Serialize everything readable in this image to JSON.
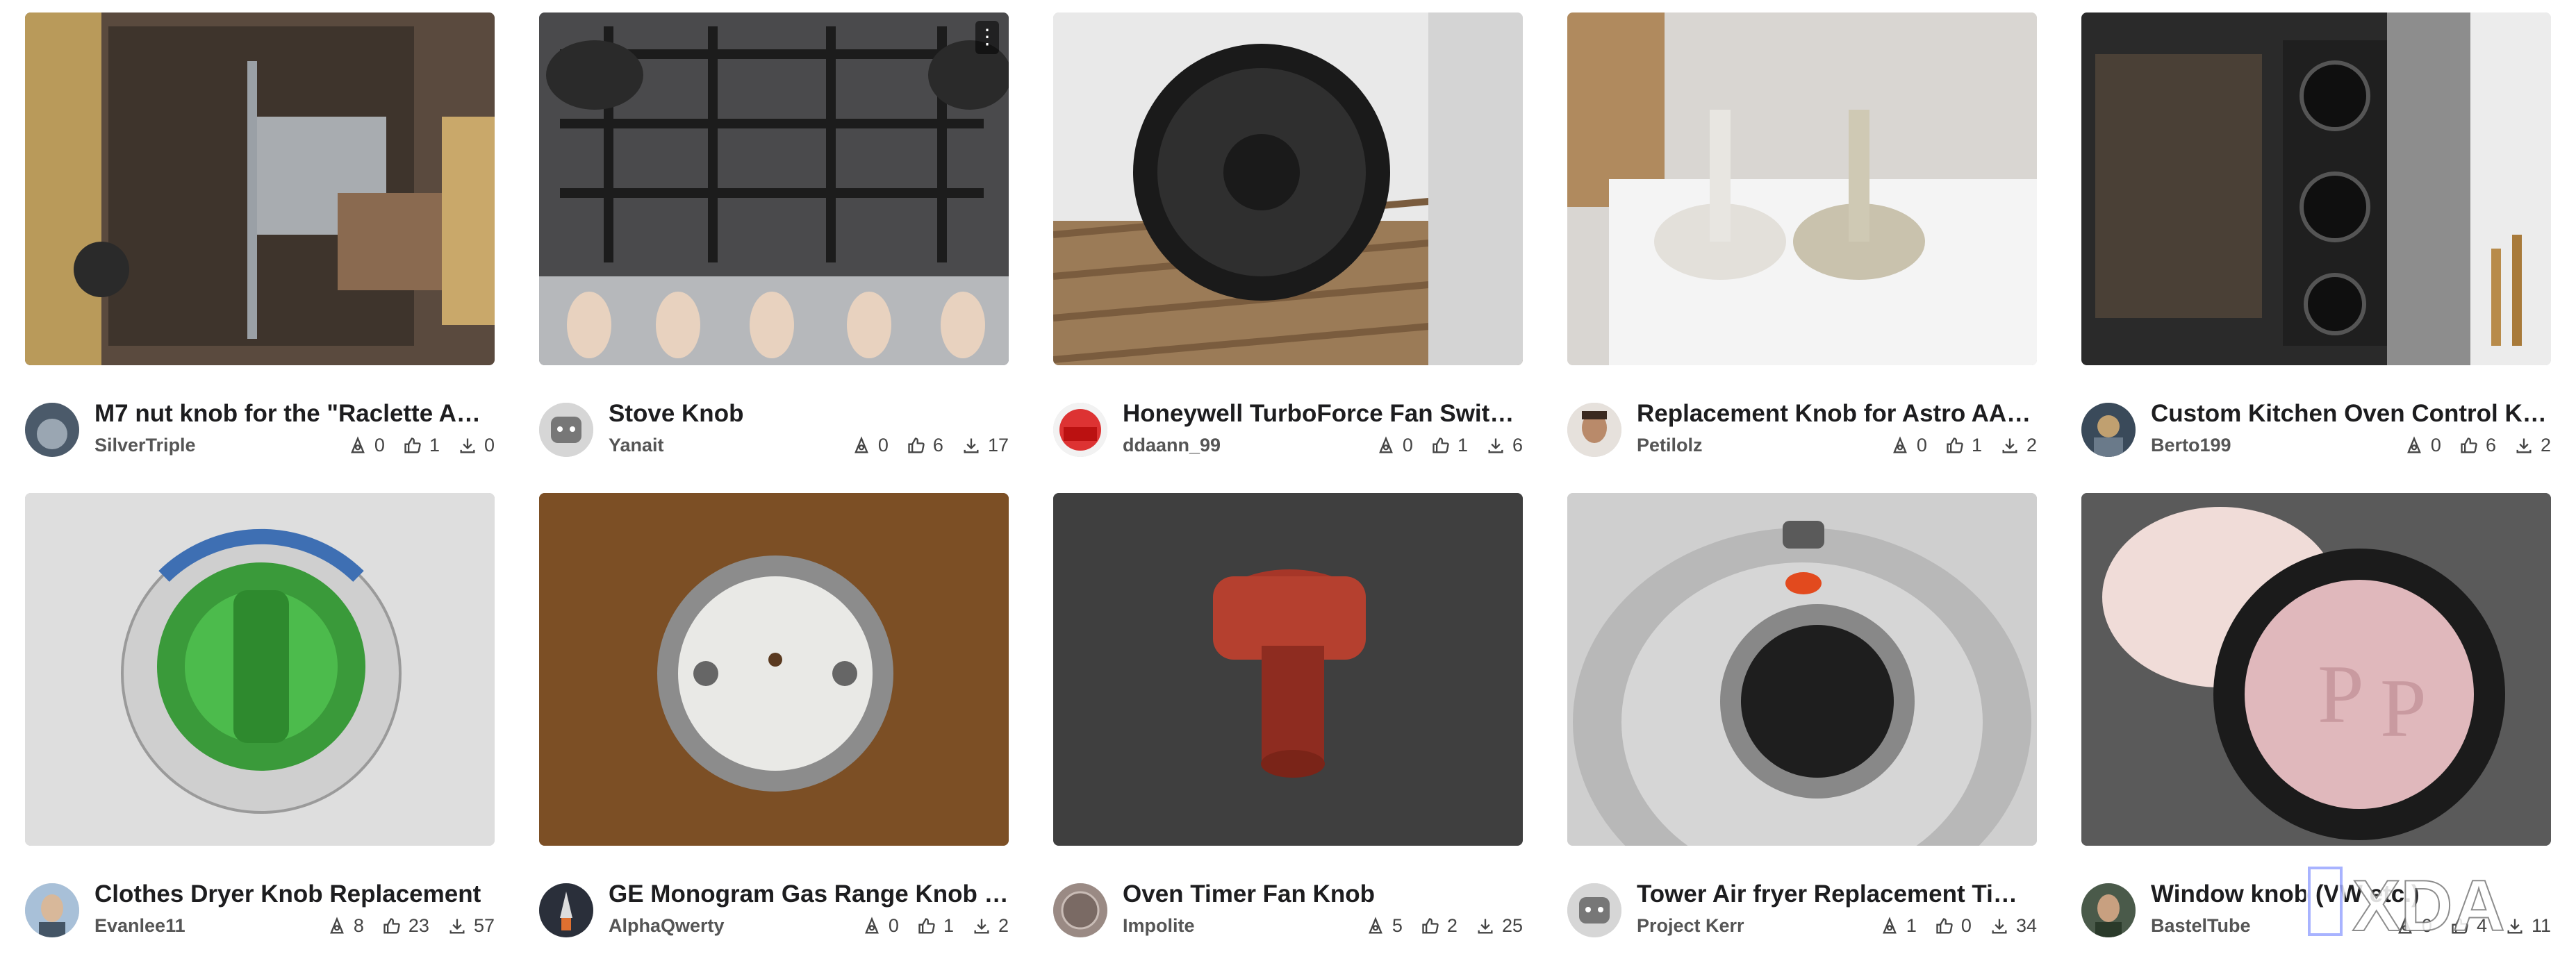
{
  "cards": [
    {
      "title": "M7 nut knob for the \"Raclette App...",
      "author": "SilverTriple",
      "stats": [
        "0",
        "1",
        "0"
      ]
    },
    {
      "title": "Stove Knob",
      "author": "Yanait",
      "stats": [
        "0",
        "6",
        "17"
      ]
    },
    {
      "title": "Honeywell TurboForce Fan Switch ...",
      "author": "ddaann_99",
      "stats": [
        "0",
        "1",
        "6"
      ]
    },
    {
      "title": "Replacement Knob for Astro AA-N...",
      "author": "Petilolz",
      "stats": [
        "0",
        "1",
        "2"
      ]
    },
    {
      "title": "Custom Kitchen Oven Control Kno...",
      "author": "Berto199",
      "stats": [
        "0",
        "6",
        "2"
      ]
    },
    {
      "title": "Clothes Dryer Knob Replacement",
      "author": "Evanlee11",
      "stats": [
        "8",
        "23",
        "57"
      ]
    },
    {
      "title": "GE Monogram Gas Range Knob Re...",
      "author": "AlphaQwerty",
      "stats": [
        "0",
        "1",
        "2"
      ]
    },
    {
      "title": "Oven Timer Fan Knob",
      "author": "Impolite",
      "stats": [
        "5",
        "2",
        "25"
      ]
    },
    {
      "title": "Tower Air fryer Replacement Time...",
      "author": "Project Kerr",
      "stats": [
        "1",
        "0",
        "34"
      ]
    },
    {
      "title": "Window knob (VW etc.)",
      "author": "BastelTube",
      "stats": [
        "0",
        "4",
        "11"
      ]
    }
  ],
  "icons": {
    "stat1": "makes-icon",
    "stat2": "like-icon",
    "stat3": "download-icon",
    "menu": "more-options-icon"
  },
  "watermark": {
    "text": "XDA"
  },
  "colors": {
    "accent": "#2f80ed",
    "text": "#1d1d1f",
    "muted": "#555555"
  }
}
